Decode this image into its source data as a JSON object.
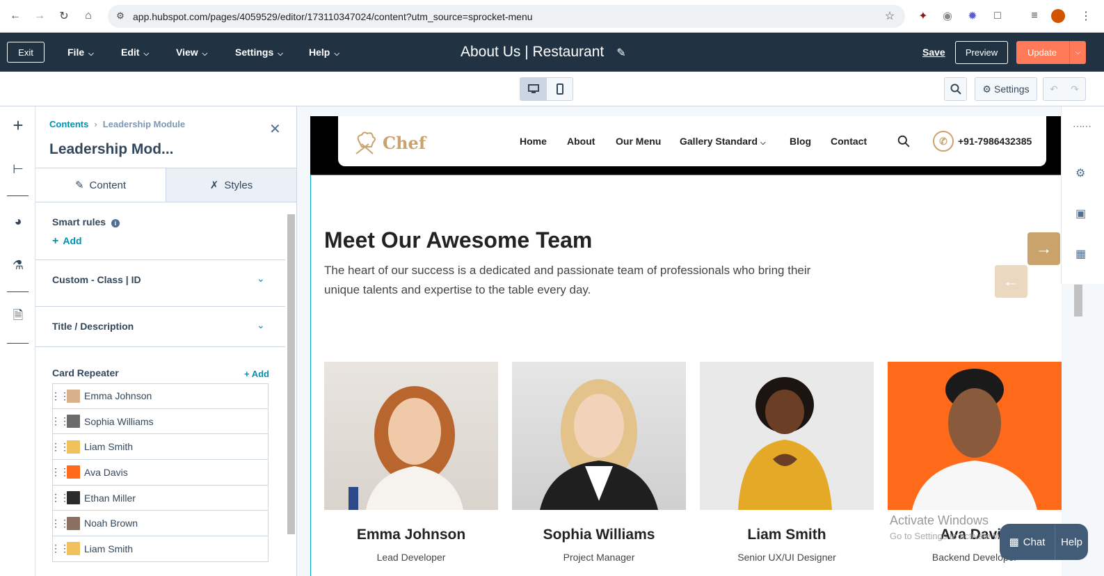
{
  "browser": {
    "url": "app.hubspot.com/pages/4059529/editor/173110347024/content?utm_source=sprocket-menu"
  },
  "nav": {
    "exit_label": "Exit",
    "menus": [
      "File",
      "Edit",
      "View",
      "Settings",
      "Help"
    ],
    "page_title": "About Us | Restaurant",
    "save_label": "Save",
    "preview_label": "Preview",
    "update_label": "Update"
  },
  "toolbar": {
    "settings_label": "Settings"
  },
  "sidebar": {
    "breadcrumb_root": "Contents",
    "breadcrumb_current": "Leadership Module",
    "title": "Leadership Mod...",
    "tabs": [
      "Content",
      "Styles"
    ],
    "smart_rules_label": "Smart rules",
    "add_label": "Add",
    "accordions": [
      "Custom - Class | ID",
      "Title / Description"
    ],
    "card_repeater_label": "Card Repeater",
    "card_add_label": "+ Add",
    "cards": [
      "Emma Johnson",
      "Sophia Williams",
      "Liam Smith",
      "Ava Davis",
      "Ethan Miller",
      "Noah Brown",
      "Liam Smith"
    ]
  },
  "site": {
    "logo_text": "Chef",
    "nav": [
      "Home",
      "About",
      "Our Menu",
      "Gallery Standard",
      "Blog",
      "Contact"
    ],
    "phone": "+91-7986432385",
    "heading": "Meet Our Awesome Team",
    "description": "The heart of our success is a dedicated and passionate team of professionals who bring their unique talents and expertise to the table every day.",
    "team": [
      {
        "name": "Emma Johnson",
        "role": "Lead Developer"
      },
      {
        "name": "Sophia Williams",
        "role": "Project Manager"
      },
      {
        "name": "Liam Smith",
        "role": "Senior UX/UI Designer"
      },
      {
        "name": "Ava Davis",
        "role": "Backend Developer"
      }
    ]
  },
  "overlay": {
    "activate_title": "Activate Windows",
    "activate_sub": "Go to Settings to activate Windows.",
    "chat_label": "Chat",
    "help_label": "Help"
  },
  "colors": {
    "nav_bg": "#213343",
    "accent": "#ff7a59",
    "link": "#0091ae",
    "brand_gold": "#c9a36b"
  }
}
